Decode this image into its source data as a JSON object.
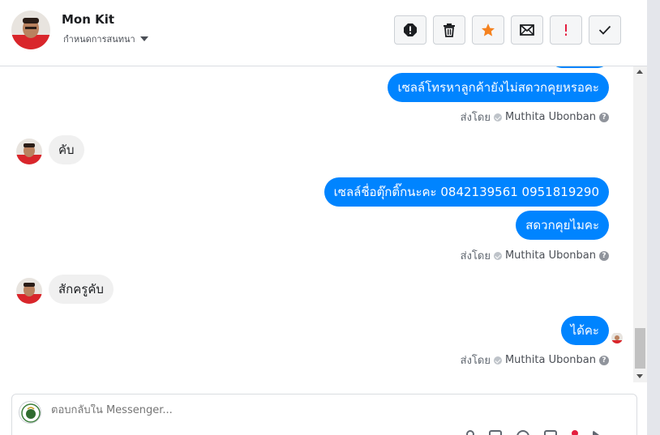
{
  "header": {
    "contact_name": "Mon Kit",
    "subtitle": "กำหนดการสนทนา"
  },
  "toolbar": {
    "buttons": [
      {
        "name": "report-spam",
        "icon": "octagon-exclamation-icon"
      },
      {
        "name": "delete",
        "icon": "trash-icon"
      },
      {
        "name": "star",
        "icon": "star-icon",
        "color": "#f5821f"
      },
      {
        "name": "mark-unread",
        "icon": "envelope-icon"
      },
      {
        "name": "mark-important",
        "icon": "exclamation-icon",
        "color": "#e41e3f"
      },
      {
        "name": "mark-done",
        "icon": "checkmark-icon"
      }
    ]
  },
  "thread": {
    "messages": [
      {
        "side": "out",
        "text": "เซลล์โทรหาลูกค้ายังไม่สดวกคุยหรอคะ"
      },
      {
        "side": "meta",
        "prefix": "ส่งโดย",
        "agent": "Muthita Ubonban"
      },
      {
        "side": "in",
        "text": "คับ"
      },
      {
        "side": "out",
        "text": "เซลล์ชื่อตุ๊กติ๊กนะคะ 0842139561    0951819290"
      },
      {
        "side": "out",
        "text": "สดวกคุยไมคะ"
      },
      {
        "side": "meta",
        "prefix": "ส่งโดย",
        "agent": "Muthita Ubonban"
      },
      {
        "side": "in",
        "text": "สักครูคับ"
      },
      {
        "side": "out",
        "text": "ได้คะ"
      },
      {
        "side": "meta",
        "prefix": "ส่งโดย",
        "agent": "Muthita Ubonban"
      }
    ],
    "help_glyph": "?"
  },
  "composer": {
    "placeholder": "ตอบกลับใน Messenger..."
  },
  "colors": {
    "accent": "#0084ff",
    "incoming_bubble": "#f0f0f0"
  }
}
